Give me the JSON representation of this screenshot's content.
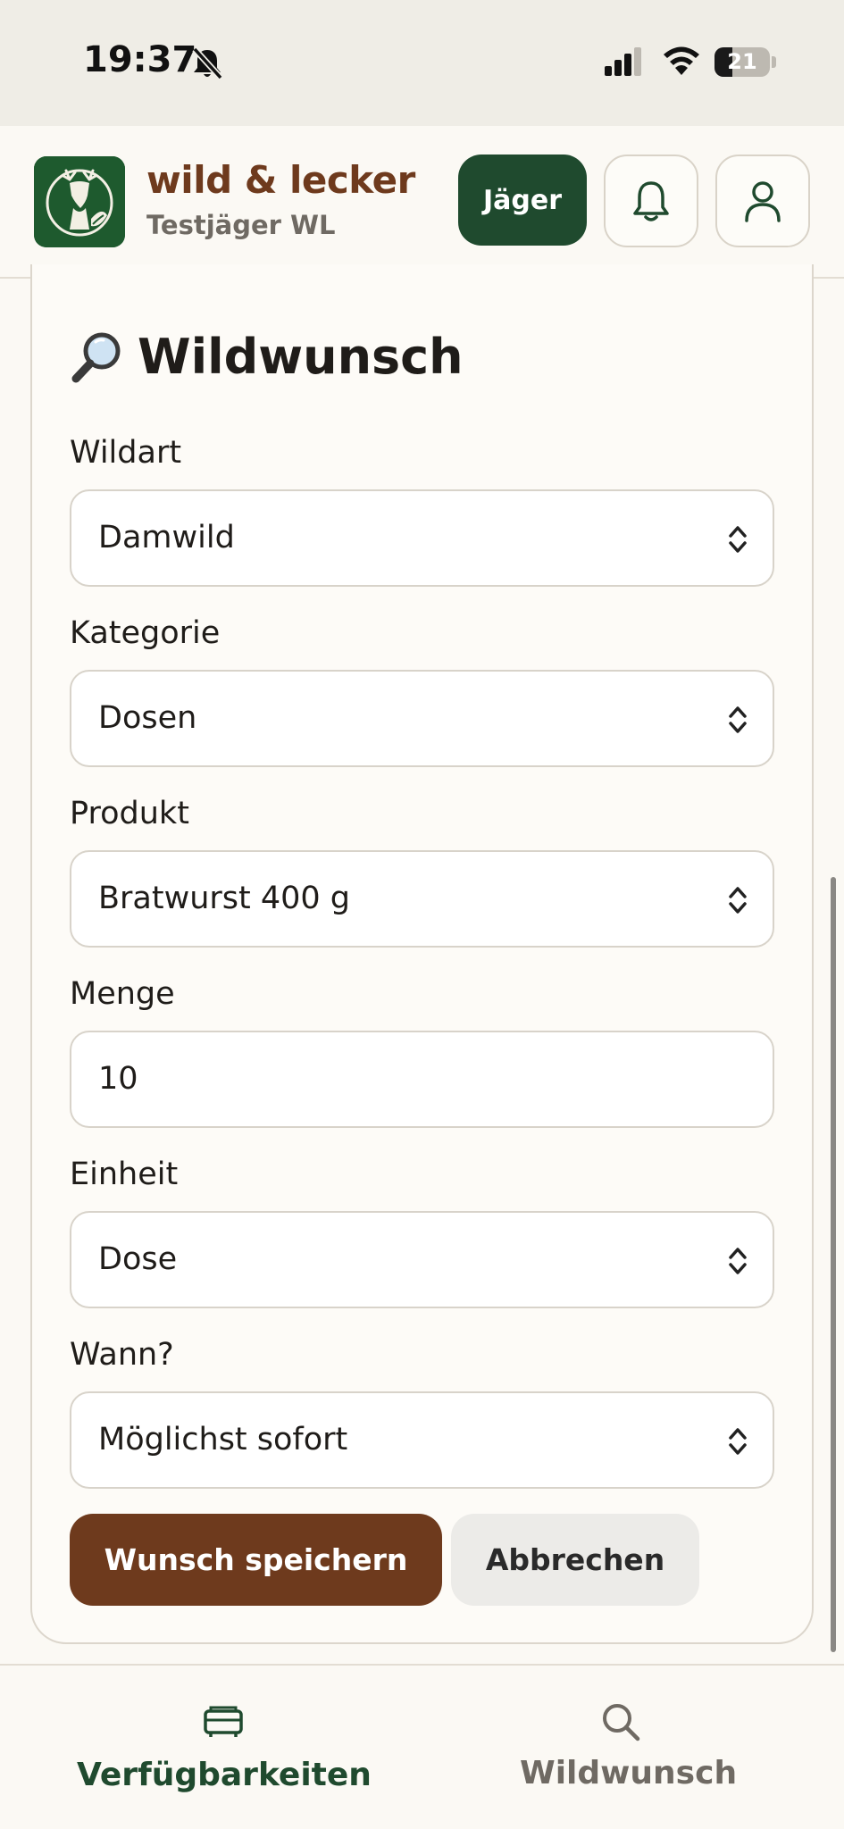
{
  "status_bar": {
    "time": "19:37",
    "battery_level": "21",
    "icons": [
      "bell-off-icon",
      "signal-icon",
      "wifi-icon",
      "battery-icon"
    ]
  },
  "header": {
    "brand_name": "wild & lecker",
    "user_name": "Testjäger WL",
    "role_button_label": "Jäger",
    "icons": [
      "deer-logo-icon",
      "bell-icon",
      "user-icon"
    ]
  },
  "form": {
    "title_icon": "magnifier-icon",
    "title": "Wildwunsch",
    "fields": {
      "wildart": {
        "label": "Wildart",
        "value": "Damwild"
      },
      "kategorie": {
        "label": "Kategorie",
        "value": "Dosen"
      },
      "produkt": {
        "label": "Produkt",
        "value": "Bratwurst 400 g"
      },
      "menge": {
        "label": "Menge",
        "value": "10"
      },
      "einheit": {
        "label": "Einheit",
        "value": "Dose"
      },
      "wann": {
        "label": "Wann?",
        "value": "Möglichst sofort"
      }
    },
    "save_label": "Wunsch speichern",
    "cancel_label": "Abbrechen"
  },
  "bottom_nav": {
    "items": [
      {
        "label": "Verfügbarkeiten",
        "icon": "availability-icon",
        "active": true
      },
      {
        "label": "Wildwunsch",
        "icon": "search-icon",
        "active": false
      }
    ]
  },
  "colors": {
    "brand_brown": "#6e3a1d",
    "brand_green": "#1f4a2e",
    "background": "#fbf9f4"
  }
}
